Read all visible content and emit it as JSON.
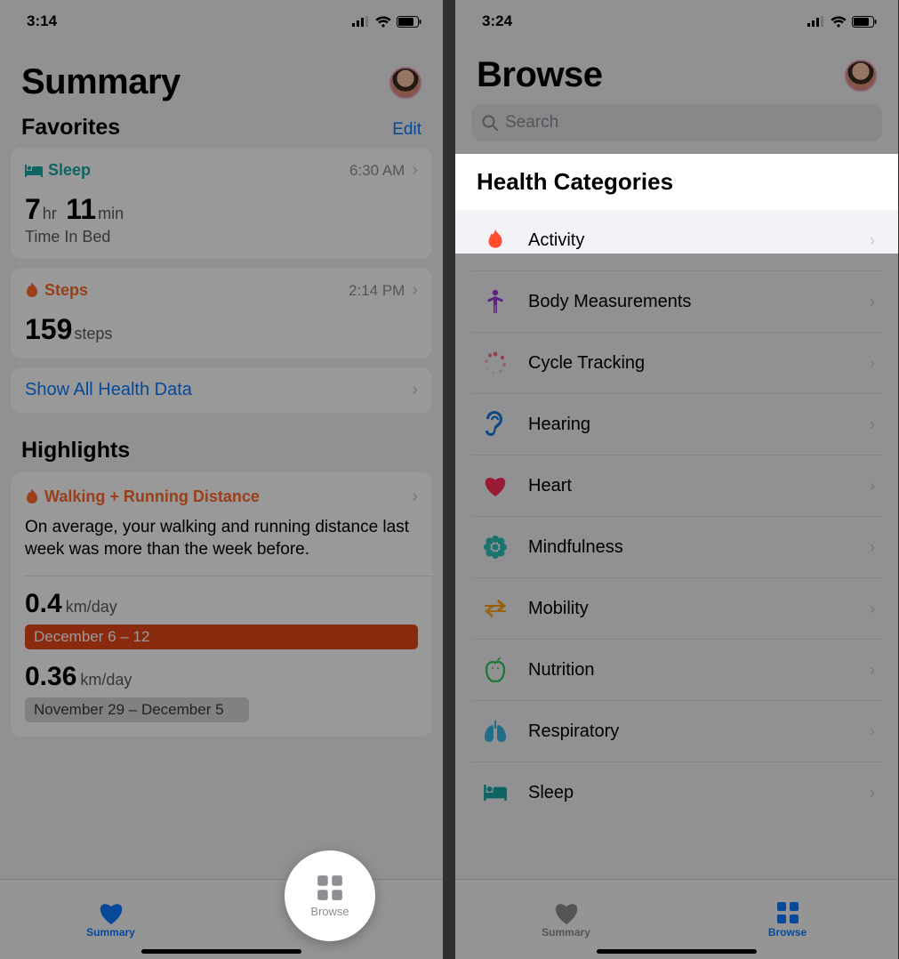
{
  "left": {
    "time": "3:14",
    "title": "Summary",
    "favorites_header": "Favorites",
    "edit": "Edit",
    "sleep": {
      "label": "Sleep",
      "time": "6:30 AM",
      "hours": "7",
      "hr_unit": "hr",
      "minutes": "11",
      "min_unit": "min",
      "sub": "Time In Bed"
    },
    "steps": {
      "label": "Steps",
      "time": "2:14 PM",
      "value": "159",
      "unit": "steps"
    },
    "show_all": "Show All Health Data",
    "highlights_header": "Highlights",
    "hl": {
      "name": "Walking + Running Distance",
      "body": "On average, your walking and running distance last week was more than the week before.",
      "v1": "0.4",
      "u1": "km/day",
      "range1": "December 6 – 12",
      "v2": "0.36",
      "u2": "km/day",
      "range2": "November 29 – December 5"
    },
    "tabs": {
      "summary": "Summary",
      "browse": "Browse"
    }
  },
  "right": {
    "time": "3:24",
    "title": "Browse",
    "search_placeholder": "Search",
    "hcat": "Health Categories",
    "cats": [
      {
        "label": "Activity"
      },
      {
        "label": "Body Measurements"
      },
      {
        "label": "Cycle Tracking"
      },
      {
        "label": "Hearing"
      },
      {
        "label": "Heart"
      },
      {
        "label": "Mindfulness"
      },
      {
        "label": "Mobility"
      },
      {
        "label": "Nutrition"
      },
      {
        "label": "Respiratory"
      },
      {
        "label": "Sleep"
      }
    ],
    "tabs": {
      "summary": "Summary",
      "browse": "Browse"
    }
  }
}
